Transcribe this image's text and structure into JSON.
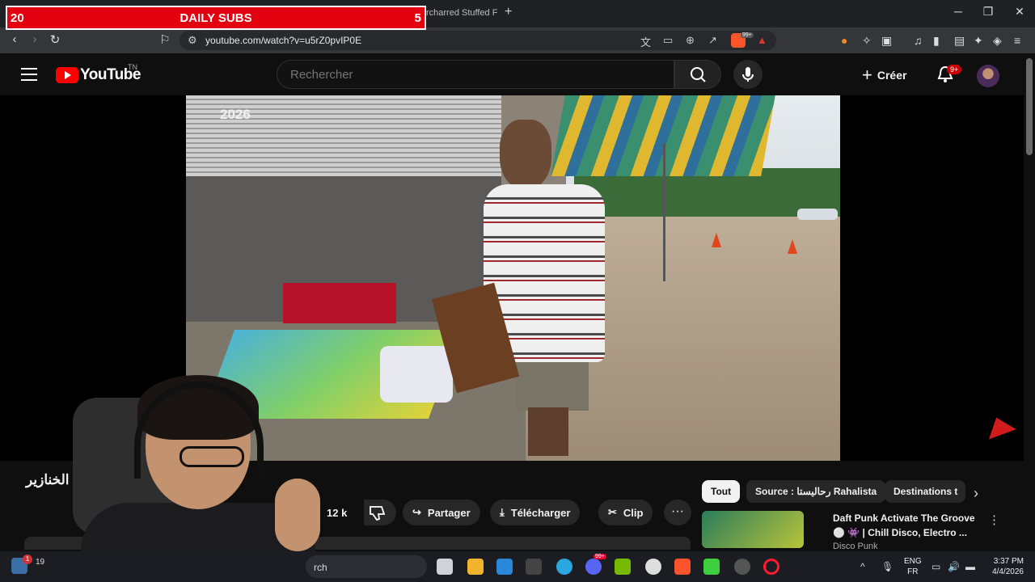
{
  "overlay": {
    "left_number": "20",
    "title": "DAILY SUBS",
    "right_number": "5"
  },
  "browser": {
    "tab_title": "rcharred Stuffed F",
    "url": "youtube.com/watch?v=u5rZ0pvIP0E"
  },
  "youtube": {
    "logo_text": "YouTube",
    "country_code": "TN",
    "search_placeholder": "Rechercher",
    "create_label": "Créer",
    "notifications_badge": "9+"
  },
  "video": {
    "title_visible": "رحاليستا الخنازير",
    "year": "2026",
    "like_count": "12 k",
    "actions": {
      "share": "Partager",
      "download": "Télécharger",
      "clip": "Clip"
    }
  },
  "chips": [
    "Tout",
    "Source : رحاليستا Rahalista",
    "Destinations t"
  ],
  "recommendation": {
    "title": "Daft Punk Activate The Groove ⚪ 👾 | Chill Disco, Electro ...",
    "channel": "Disco Punk"
  },
  "taskbar": {
    "search_text": "rch",
    "weather_temp": "19",
    "weather_badge": "1",
    "lang_top": "ENG",
    "lang_bottom": "FR",
    "time": "3:37 PM",
    "date": "4/4/2026",
    "discord_badge": "99+"
  },
  "colors": {
    "overlay_red": "#e3000f",
    "yt_red": "#ff0000",
    "background": "#0f0f0f"
  }
}
